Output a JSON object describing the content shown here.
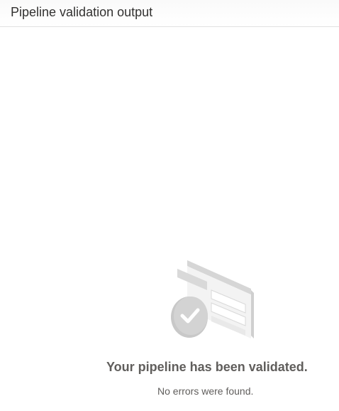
{
  "header": {
    "title": "Pipeline validation output"
  },
  "empty_state": {
    "icon": "validated-checkmark-illustration",
    "title": "Your pipeline has been validated.",
    "subtitle": "No errors were found."
  },
  "colors": {
    "title_text": "#323130",
    "body_text": "#605e5c",
    "illustration_light": "#f0f0f0",
    "illustration_mid": "#d9d9d9",
    "illustration_dark": "#bdbdbd"
  }
}
